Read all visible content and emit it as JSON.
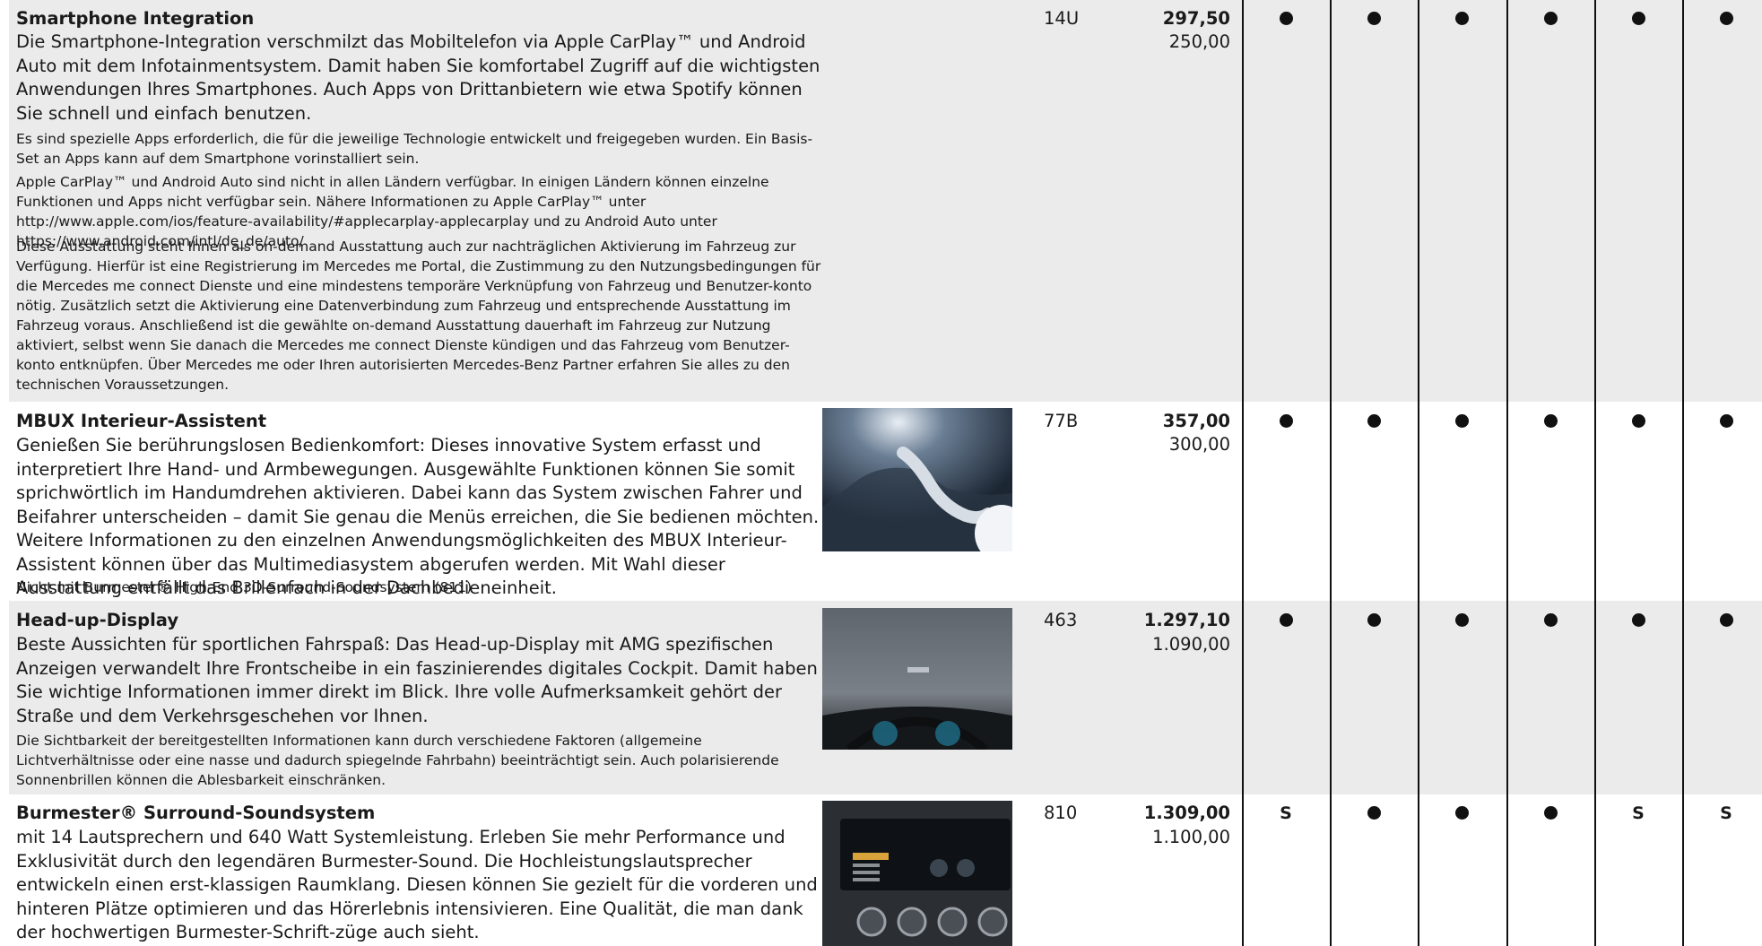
{
  "rows": [
    {
      "title": "Smartphone Integration",
      "description": "Die Smartphone-Integration verschmilzt das Mobiltelefon via Apple CarPlay™ und Android Auto mit dem Infotainmentsystem. Damit haben Sie komfortabel Zugriff auf die wichtigsten Anwendungen Ihres Smartphones. Auch Apps von Drittanbietern wie etwa Spotify können Sie schnell und einfach benutzen.",
      "notes": [
        "Es sind spezielle Apps erforderlich, die für die jeweilige Technologie entwickelt und freigegeben wurden. Ein Basis-Set an Apps kann auf dem Smartphone vorinstalliert sein.",
        "Apple CarPlay™ und Android Auto sind nicht in allen Ländern verfügbar. In einigen Ländern können einzelne Funktionen und Apps nicht verfügbar sein. Nähere Informationen zu Apple CarPlay™ unter http://www.apple.com/ios/feature-availability/#applecarplay-applecarplay und zu Android Auto unter https://www.android.com/intl/de_de/auto/",
        "Diese Ausstattung steht Ihnen als on-demand Ausstattung auch zur nachträglichen Aktivierung im Fahrzeug zur Verfügung. Hierfür ist eine Registrierung im Mercedes me Portal, die Zustimmung zu den Nutzungsbedingungen für die Mercedes me connect Dienste und eine mindestens temporäre Verknüpfung von Fahrzeug und Benutzer-konto nötig. Zusätzlich setzt die Aktivierung eine Datenverbindung zum Fahrzeug und entsprechende Ausstattung im Fahrzeug voraus. Anschließend ist die gewählte on-demand Ausstattung dauerhaft im Fahrzeug zur Nutzung aktiviert, selbst wenn Sie danach die Mercedes me connect Dienste kündigen und das Fahrzeug vom Benutzer-konto entknüpfen. Über Mercedes me oder Ihren autorisierten Mercedes-Benz Partner erfahren Sie alles zu den technischen Voraussetzungen."
      ],
      "code": "14U",
      "price_gross": "297,50",
      "price_net": "250,00",
      "availability": [
        "●",
        "●",
        "●",
        "●",
        "●",
        "●"
      ]
    },
    {
      "title": "MBUX Interieur-Assistent",
      "description": "Genießen Sie berührungslosen Bedienkomfort: Dieses innovative System erfasst und interpretiert Ihre Hand- und Armbewegungen. Ausgewählte Funktionen können Sie somit sprichwörtlich im Handumdrehen aktivieren. Dabei kann das System zwischen Fahrer und Beifahrer unterscheiden – damit Sie genau die Menüs erreichen, die Sie bedienen möchten. Weitere Informationen zu den einzelnen Anwendungsmöglichkeiten des MBUX Interieur-Assistent können über das Multimediasystem abgerufen werden. Mit Wahl dieser Ausstattung entfällt das Brillenfach in der Dachbedieneinheit.",
      "notes": [
        "Nicht mit Burmester® High-End 3D-Surround-Soundsystem (811)"
      ],
      "code": "77B",
      "price_gross": "357,00",
      "price_net": "300,00",
      "availability": [
        "●",
        "●",
        "●",
        "●",
        "●",
        "●"
      ]
    },
    {
      "title": "Head-up-Display",
      "description": "Beste Aussichten für sportlichen Fahrspaß: Das Head-up-Display mit AMG spezifischen Anzeigen verwandelt Ihre Frontscheibe in ein faszinierendes digitales Cockpit. Damit haben Sie wichtige Informationen immer direkt im Blick. Ihre volle Aufmerksamkeit gehört der Straße und dem Verkehrsgeschehen vor Ihnen.",
      "notes": [
        "Die Sichtbarkeit der bereitgestellten Informationen kann durch verschiedene Faktoren (allgemeine Lichtverhältnisse oder eine nasse und dadurch spiegelnde Fahrbahn) beeinträchtigt sein. Auch polarisierende Sonnenbrillen können die Ablesbarkeit einschränken."
      ],
      "code": "463",
      "price_gross": "1.297,10",
      "price_net": "1.090,00",
      "availability": [
        "●",
        "●",
        "●",
        "●",
        "●",
        "●"
      ]
    },
    {
      "title": "Burmester® Surround-Soundsystem",
      "description": "mit 14 Lautsprechern und 640 Watt Systemleistung. Erleben Sie mehr Performance und Exklusivität durch den legendären Burmester-Sound. Die Hochleistungslautsprecher entwickeln einen erst-klassigen Raumklang. Diesen können Sie gezielt für die vorderen und hinteren Plätze optimieren und das Hörerlebnis intensivieren. Eine Qualität, die man dank der hochwertigen Burmester-Schrift-züge auch sieht.",
      "notes": [],
      "code": "810",
      "price_gross": "1.309,00",
      "price_net": "1.100,00",
      "availability": [
        "S",
        "●",
        "●",
        "●",
        "S",
        "S"
      ]
    }
  ]
}
